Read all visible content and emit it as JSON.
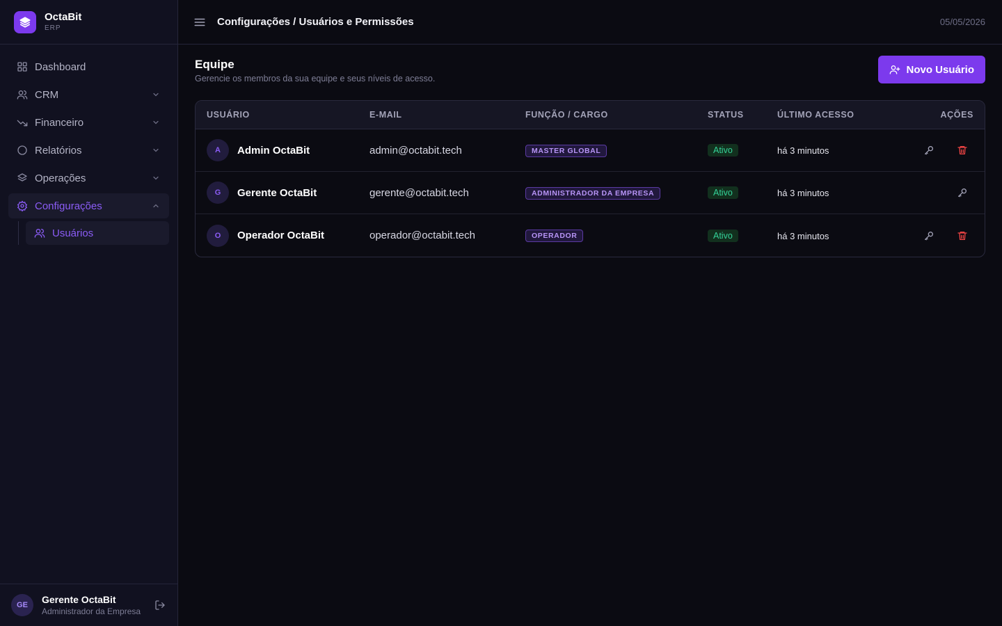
{
  "brand": {
    "name": "OctaBit",
    "sub": "ERP"
  },
  "sidebar": {
    "items": [
      {
        "label": "Dashboard",
        "icon": "grid-icon"
      },
      {
        "label": "CRM",
        "icon": "users-icon"
      },
      {
        "label": "Financeiro",
        "icon": "trend-down-icon"
      },
      {
        "label": "Relatórios",
        "icon": "circle-icon"
      },
      {
        "label": "Operações",
        "icon": "layers-icon"
      },
      {
        "label": "Configurações",
        "icon": "gear-icon"
      }
    ],
    "subitems": [
      {
        "label": "Usuários",
        "icon": "users-icon"
      }
    ]
  },
  "user": {
    "name": "Gerente OctaBit",
    "role": "Administrador da Empresa",
    "initials": "GE"
  },
  "topbar": {
    "breadcrumb": "Configurações / Usuários e Permissões",
    "date": "05/05/2026"
  },
  "page": {
    "title": "Equipe",
    "subtitle": "Gerencie os membros da sua equipe e seus níveis de acesso.",
    "new_button": "Novo Usuário"
  },
  "table": {
    "headers": {
      "user": "USUÁRIO",
      "email": "E-MAIL",
      "role": "FUNÇÃO / CARGO",
      "status": "STATUS",
      "last": "ÚLTIMO ACESSO",
      "actions": "AÇÕES"
    },
    "rows": [
      {
        "initial": "A",
        "name": "Admin OctaBit",
        "email": "admin@octabit.tech",
        "role": "MASTER GLOBAL",
        "status": "Ativo",
        "last": "há 3 minutos",
        "can_delete": true
      },
      {
        "initial": "G",
        "name": "Gerente OctaBit",
        "email": "gerente@octabit.tech",
        "role": "ADMINISTRADOR DA EMPRESA",
        "status": "Ativo",
        "last": "há 3 minutos",
        "can_delete": false
      },
      {
        "initial": "O",
        "name": "Operador OctaBit",
        "email": "operador@octabit.tech",
        "role": "OPERADOR",
        "status": "Ativo",
        "last": "há 3 minutos",
        "can_delete": true
      }
    ]
  },
  "colors": {
    "accent": "#7c3aed",
    "accent_text": "#8b5cf6",
    "status_active": "#34d399",
    "danger": "#ef4444"
  }
}
